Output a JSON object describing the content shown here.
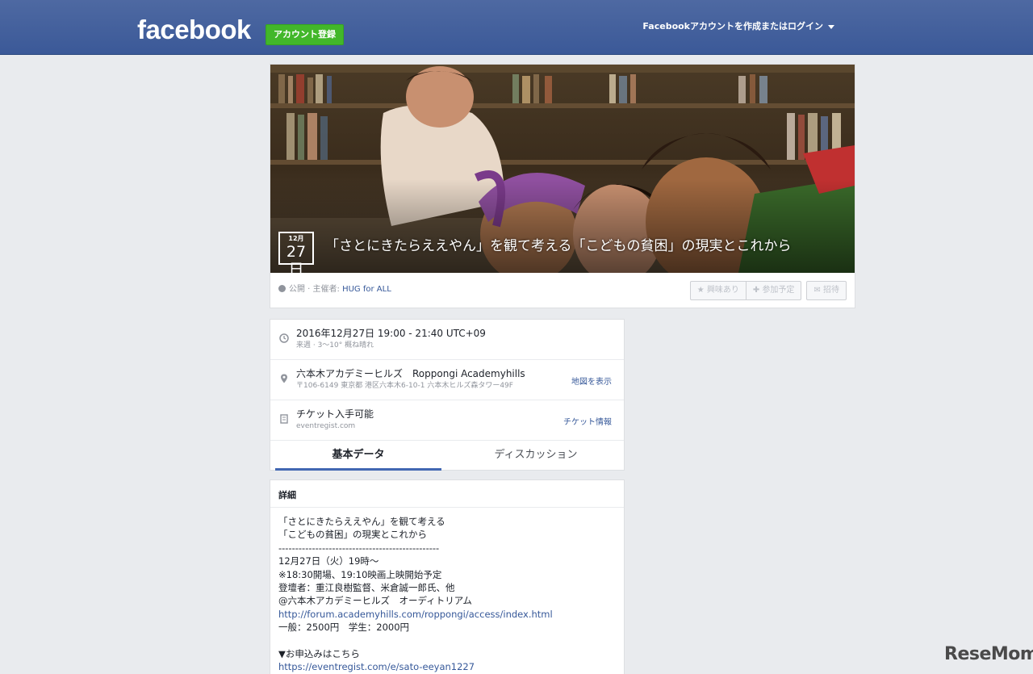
{
  "header": {
    "logo": "facebook",
    "signup_label": "アカウント登録",
    "login_label": "Facebookアカウントを作成またはログイン"
  },
  "event": {
    "date_month": "12月",
    "date_day": "27日",
    "title": "「さとにきたらええやん」を観て考える「こどもの貧困」の現実とこれから",
    "privacy": "公開",
    "host_prefix": " · 主催者: ",
    "host": "HUG for ALL",
    "actions": {
      "interested": "★ 興味あり",
      "going": "✚ 参加予定",
      "invite": "✉ 招待"
    }
  },
  "info": {
    "time": {
      "main": "2016年12月27日 19:00 - 21:40 UTC+09",
      "sub": "来週 · 3〜10° 概ね晴れ"
    },
    "place": {
      "main": "六本木アカデミーヒルズ　Roppongi Academyhills",
      "sub": "〒106-6149 東京都 港区六本木6-10-1 六本木ヒルズ森タワー49F",
      "link": "地図を表示"
    },
    "ticket": {
      "main": "チケット入手可能",
      "sub": "eventregist.com",
      "link": "チケット情報"
    }
  },
  "tabs": [
    "基本データ",
    "ディスカッション"
  ],
  "details": {
    "heading": "詳細",
    "lines": [
      "「さとにきたらええやん」を観て考える",
      "「こどもの貧困」の現実とこれから",
      "------------------------------------------------",
      "12月27日（火）19時〜",
      "※18:30開場、19:10映画上映開始予定",
      "登壇者：重江良樹監督、米倉誠一郎氏、他",
      "@六本木アカデミーヒルズ　オーディトリアム",
      "http://forum.academyhills.com/roppongi/access/index.html",
      "一般：2500円　学生：2000円",
      "",
      "▼お申込みはこちら",
      "https://eventregist.com/e/sato-eeyan1227"
    ]
  },
  "watermark": "ReseMom"
}
